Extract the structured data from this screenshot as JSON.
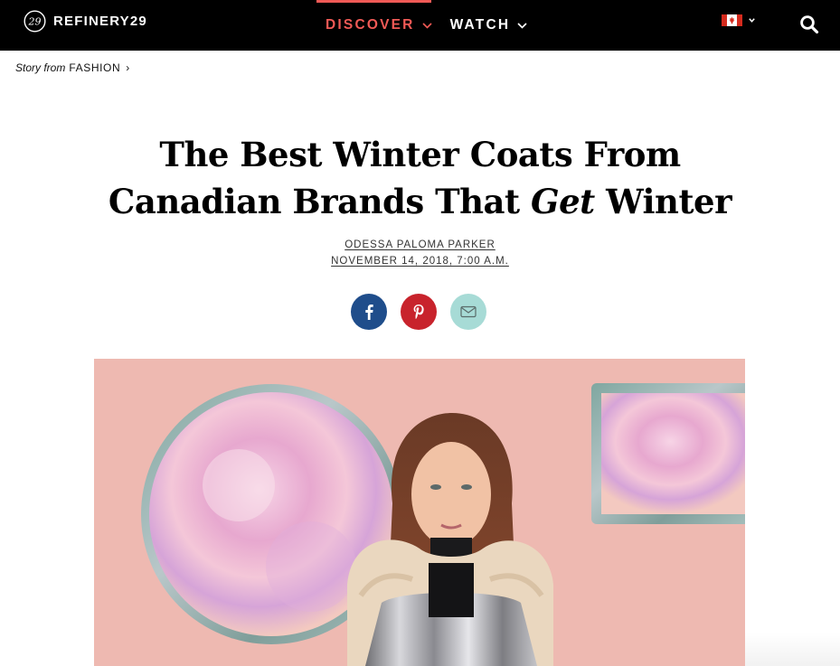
{
  "header": {
    "logo_text": "REFINERY29",
    "nav": [
      {
        "label": "DISCOVER",
        "active": true
      },
      {
        "label": "WATCH",
        "active": false
      }
    ],
    "locale_flag": "canada-flag-icon",
    "accent_color": "#f05a56"
  },
  "breadcrumb": {
    "prefix": "Story from",
    "section": "FASHION"
  },
  "article": {
    "title_part1": "The Best Winter Coats From Canadian Brands That ",
    "title_emphasis": "Get",
    "title_part2": " Winter",
    "author": "ODESSA PALOMA PARKER",
    "date": "NOVEMBER 14, 2018, 7:00 A.M."
  },
  "share": [
    {
      "name": "facebook",
      "icon": "facebook-icon",
      "color": "#1f4d8b"
    },
    {
      "name": "pinterest",
      "icon": "pinterest-icon",
      "color": "#c8232c"
    },
    {
      "name": "email",
      "icon": "email-icon",
      "color": "#a7dbd6"
    }
  ],
  "hero": {
    "image_subject": "model-in-silver-puffer-coat-with-fur-hood",
    "background_color": "#eeb9b1"
  }
}
